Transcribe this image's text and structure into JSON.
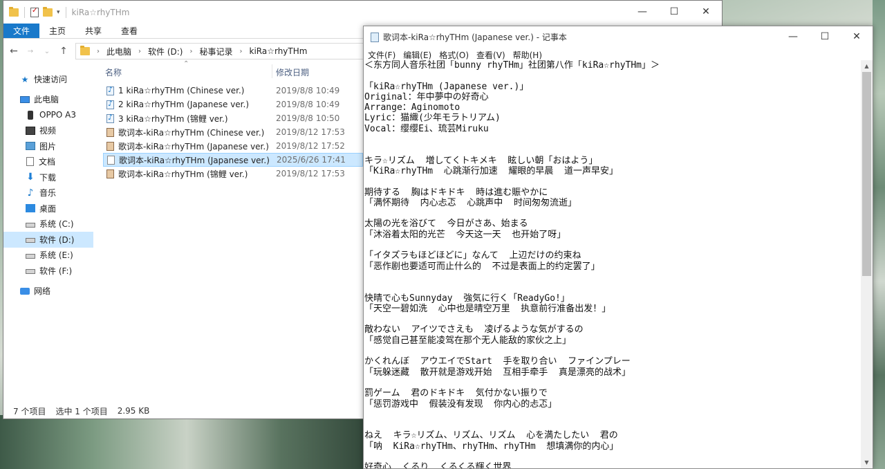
{
  "explorer": {
    "title": "kiRa☆rhyTHm",
    "ribbon": {
      "file_tab": "文件",
      "tabs": [
        "主页",
        "共享",
        "查看"
      ]
    },
    "address": {
      "crumbs": [
        "此电脑",
        "软件 (D:)",
        "秘事记录",
        "kiRa☆rhyTHm"
      ]
    },
    "sidebar": {
      "items": [
        {
          "label": "快速访问",
          "icon": "star-icon"
        },
        {
          "label": "此电脑",
          "icon": "computer-icon"
        },
        {
          "label": "OPPO A3",
          "icon": "phone-icon"
        },
        {
          "label": "视频",
          "icon": "video-icon"
        },
        {
          "label": "图片",
          "icon": "pictures-icon"
        },
        {
          "label": "文档",
          "icon": "documents-icon"
        },
        {
          "label": "下载",
          "icon": "download-icon"
        },
        {
          "label": "音乐",
          "icon": "music-icon"
        },
        {
          "label": "桌面",
          "icon": "desktop-icon"
        },
        {
          "label": "系统 (C:)",
          "icon": "drive-icon"
        },
        {
          "label": "软件 (D:)",
          "icon": "drive-icon"
        },
        {
          "label": "系统 (E:)",
          "icon": "drive-icon"
        },
        {
          "label": "软件 (F:)",
          "icon": "drive-icon"
        },
        {
          "label": "网络",
          "icon": "network-icon"
        }
      ]
    },
    "columns": {
      "name": "名称",
      "date": "修改日期"
    },
    "files": [
      {
        "name": "1 kiRa☆rhyTHm (Chinese ver.)",
        "date": "2019/8/8 10:49",
        "type": "audio"
      },
      {
        "name": "2 kiRa☆rhyTHm (Japanese ver.)",
        "date": "2019/8/8 10:49",
        "type": "audio"
      },
      {
        "name": "3 kiRa☆rhyTHm (锦鲤 ver.)",
        "date": "2019/8/8 10:50",
        "type": "audio"
      },
      {
        "name": "歌词本-kiRa☆rhyTHm (Chinese ver.)",
        "date": "2019/8/12 17:53",
        "type": "image"
      },
      {
        "name": "歌词本-kiRa☆rhyTHm (Japanese ver.)",
        "date": "2019/8/12 17:52",
        "type": "image"
      },
      {
        "name": "歌词本-kiRa☆rhyTHm (Japanese ver.)",
        "date": "2025/6/26 17:41",
        "type": "text",
        "selected": true
      },
      {
        "name": "歌词本-kiRa☆rhyTHm (锦鲤 ver.)",
        "date": "2019/8/12 17:53",
        "type": "image"
      }
    ],
    "status": {
      "count": "7 个项目",
      "selection": "选中 1 个项目",
      "size": "2.95 KB"
    }
  },
  "notepad": {
    "title": "歌词本-kiRa☆rhyTHm (Japanese ver.) - 记事本",
    "menu": [
      "文件(F)",
      "编辑(E)",
      "格式(O)",
      "查看(V)",
      "帮助(H)"
    ],
    "lines": [
      "＜东方同人音乐社团「bunny rhyTHm」社团第八作「kiRa☆rhyTHm」＞",
      "",
      "「kiRa☆rhyTHm (Japanese ver.)」",
      "Original：年中夢中の好奇心",
      "Arrange：Aginomoto",
      "Lyric：猫織(少年モラトリアム)",
      "Vocal：缨缨Ei、琉芸Miruku",
      "",
      "",
      "キラ☆リズム  増してくトキメキ  眩しい朝「おはよう」",
      "「KiRa☆rhyTHm  心跳渐行加速  耀眼的早晨  道一声早安」",
      "",
      "期待する  胸はドキドキ  時は進む賑やかに",
      "「满怀期待  内心忐忑  心跳声中  时间匆匆流逝」",
      "",
      "太陽の光を浴びて  今日がさあ、始まる",
      "「沐浴着太阳的光芒  今天这一天  也开始了呀」",
      "",
      "「イタズラもほどほどに」なんて  上辺だけの约束ね",
      "「恶作剧也要适可而止什么的  不过是表面上的约定罢了」",
      "",
      "",
      "快晴で心もSunnyday  強気に行く「ReadyGo!」",
      "「天空一碧如洗  心中也是晴空万里  执意前行准备出发！」",
      "",
      "敵わない  アイツでさえも  凌げるような気がするの",
      "「感觉自己甚至能凌驾在那个无人能敌的家伙之上」",
      "",
      "かくれんぼ  アウエイでStart  手を取り合い  ファインプレー",
      "「玩躲迷藏  散开就是游戏开始  互相手牵手  真是漂亮的战术」",
      "",
      "罰ゲーム  君のドキドキ  気付かない振りで",
      "「惩罚游戏中  假装没有发现  你内心的忐忑」",
      "",
      "",
      "ねえ  キラ☆リズム、リズム、リズム  心を満たしたい  君の",
      "「呐  KiRa☆rhyTHm、rhyTHm、rhyTHm  想填满你的内心」",
      "",
      "好奇心  くるり  くるくる輝く世界"
    ]
  }
}
